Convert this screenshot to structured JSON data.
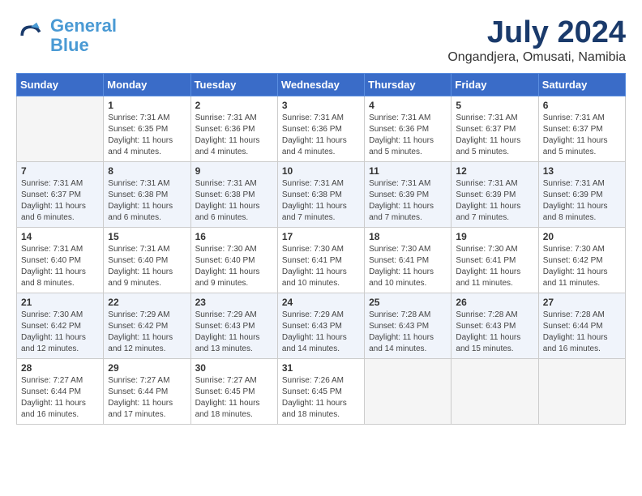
{
  "header": {
    "logo_general": "General",
    "logo_blue": "Blue",
    "month_title": "July 2024",
    "location": "Ongandjera, Omusati, Namibia"
  },
  "days_of_week": [
    "Sunday",
    "Monday",
    "Tuesday",
    "Wednesday",
    "Thursday",
    "Friday",
    "Saturday"
  ],
  "weeks": [
    [
      {
        "day": "",
        "sunrise": "",
        "sunset": "",
        "daylight": ""
      },
      {
        "day": "1",
        "sunrise": "Sunrise: 7:31 AM",
        "sunset": "Sunset: 6:35 PM",
        "daylight": "Daylight: 11 hours and 4 minutes."
      },
      {
        "day": "2",
        "sunrise": "Sunrise: 7:31 AM",
        "sunset": "Sunset: 6:36 PM",
        "daylight": "Daylight: 11 hours and 4 minutes."
      },
      {
        "day": "3",
        "sunrise": "Sunrise: 7:31 AM",
        "sunset": "Sunset: 6:36 PM",
        "daylight": "Daylight: 11 hours and 4 minutes."
      },
      {
        "day": "4",
        "sunrise": "Sunrise: 7:31 AM",
        "sunset": "Sunset: 6:36 PM",
        "daylight": "Daylight: 11 hours and 5 minutes."
      },
      {
        "day": "5",
        "sunrise": "Sunrise: 7:31 AM",
        "sunset": "Sunset: 6:37 PM",
        "daylight": "Daylight: 11 hours and 5 minutes."
      },
      {
        "day": "6",
        "sunrise": "Sunrise: 7:31 AM",
        "sunset": "Sunset: 6:37 PM",
        "daylight": "Daylight: 11 hours and 5 minutes."
      }
    ],
    [
      {
        "day": "7",
        "sunrise": "Sunrise: 7:31 AM",
        "sunset": "Sunset: 6:37 PM",
        "daylight": "Daylight: 11 hours and 6 minutes."
      },
      {
        "day": "8",
        "sunrise": "Sunrise: 7:31 AM",
        "sunset": "Sunset: 6:38 PM",
        "daylight": "Daylight: 11 hours and 6 minutes."
      },
      {
        "day": "9",
        "sunrise": "Sunrise: 7:31 AM",
        "sunset": "Sunset: 6:38 PM",
        "daylight": "Daylight: 11 hours and 6 minutes."
      },
      {
        "day": "10",
        "sunrise": "Sunrise: 7:31 AM",
        "sunset": "Sunset: 6:38 PM",
        "daylight": "Daylight: 11 hours and 7 minutes."
      },
      {
        "day": "11",
        "sunrise": "Sunrise: 7:31 AM",
        "sunset": "Sunset: 6:39 PM",
        "daylight": "Daylight: 11 hours and 7 minutes."
      },
      {
        "day": "12",
        "sunrise": "Sunrise: 7:31 AM",
        "sunset": "Sunset: 6:39 PM",
        "daylight": "Daylight: 11 hours and 7 minutes."
      },
      {
        "day": "13",
        "sunrise": "Sunrise: 7:31 AM",
        "sunset": "Sunset: 6:39 PM",
        "daylight": "Daylight: 11 hours and 8 minutes."
      }
    ],
    [
      {
        "day": "14",
        "sunrise": "Sunrise: 7:31 AM",
        "sunset": "Sunset: 6:40 PM",
        "daylight": "Daylight: 11 hours and 8 minutes."
      },
      {
        "day": "15",
        "sunrise": "Sunrise: 7:31 AM",
        "sunset": "Sunset: 6:40 PM",
        "daylight": "Daylight: 11 hours and 9 minutes."
      },
      {
        "day": "16",
        "sunrise": "Sunrise: 7:30 AM",
        "sunset": "Sunset: 6:40 PM",
        "daylight": "Daylight: 11 hours and 9 minutes."
      },
      {
        "day": "17",
        "sunrise": "Sunrise: 7:30 AM",
        "sunset": "Sunset: 6:41 PM",
        "daylight": "Daylight: 11 hours and 10 minutes."
      },
      {
        "day": "18",
        "sunrise": "Sunrise: 7:30 AM",
        "sunset": "Sunset: 6:41 PM",
        "daylight": "Daylight: 11 hours and 10 minutes."
      },
      {
        "day": "19",
        "sunrise": "Sunrise: 7:30 AM",
        "sunset": "Sunset: 6:41 PM",
        "daylight": "Daylight: 11 hours and 11 minutes."
      },
      {
        "day": "20",
        "sunrise": "Sunrise: 7:30 AM",
        "sunset": "Sunset: 6:42 PM",
        "daylight": "Daylight: 11 hours and 11 minutes."
      }
    ],
    [
      {
        "day": "21",
        "sunrise": "Sunrise: 7:30 AM",
        "sunset": "Sunset: 6:42 PM",
        "daylight": "Daylight: 11 hours and 12 minutes."
      },
      {
        "day": "22",
        "sunrise": "Sunrise: 7:29 AM",
        "sunset": "Sunset: 6:42 PM",
        "daylight": "Daylight: 11 hours and 12 minutes."
      },
      {
        "day": "23",
        "sunrise": "Sunrise: 7:29 AM",
        "sunset": "Sunset: 6:43 PM",
        "daylight": "Daylight: 11 hours and 13 minutes."
      },
      {
        "day": "24",
        "sunrise": "Sunrise: 7:29 AM",
        "sunset": "Sunset: 6:43 PM",
        "daylight": "Daylight: 11 hours and 14 minutes."
      },
      {
        "day": "25",
        "sunrise": "Sunrise: 7:28 AM",
        "sunset": "Sunset: 6:43 PM",
        "daylight": "Daylight: 11 hours and 14 minutes."
      },
      {
        "day": "26",
        "sunrise": "Sunrise: 7:28 AM",
        "sunset": "Sunset: 6:43 PM",
        "daylight": "Daylight: 11 hours and 15 minutes."
      },
      {
        "day": "27",
        "sunrise": "Sunrise: 7:28 AM",
        "sunset": "Sunset: 6:44 PM",
        "daylight": "Daylight: 11 hours and 16 minutes."
      }
    ],
    [
      {
        "day": "28",
        "sunrise": "Sunrise: 7:27 AM",
        "sunset": "Sunset: 6:44 PM",
        "daylight": "Daylight: 11 hours and 16 minutes."
      },
      {
        "day": "29",
        "sunrise": "Sunrise: 7:27 AM",
        "sunset": "Sunset: 6:44 PM",
        "daylight": "Daylight: 11 hours and 17 minutes."
      },
      {
        "day": "30",
        "sunrise": "Sunrise: 7:27 AM",
        "sunset": "Sunset: 6:45 PM",
        "daylight": "Daylight: 11 hours and 18 minutes."
      },
      {
        "day": "31",
        "sunrise": "Sunrise: 7:26 AM",
        "sunset": "Sunset: 6:45 PM",
        "daylight": "Daylight: 11 hours and 18 minutes."
      },
      {
        "day": "",
        "sunrise": "",
        "sunset": "",
        "daylight": ""
      },
      {
        "day": "",
        "sunrise": "",
        "sunset": "",
        "daylight": ""
      },
      {
        "day": "",
        "sunrise": "",
        "sunset": "",
        "daylight": ""
      }
    ]
  ]
}
